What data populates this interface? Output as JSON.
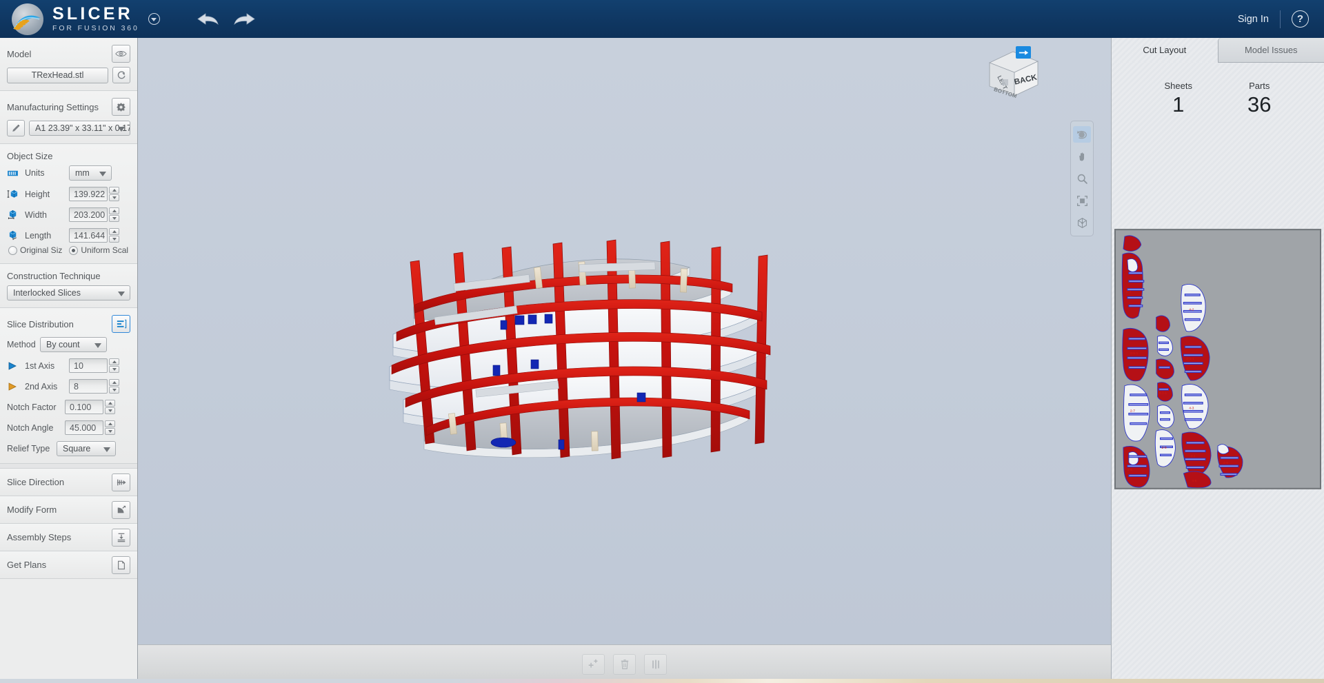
{
  "app": {
    "logo_title": "SLICER",
    "logo_subtitle": "FOR FUSION 360",
    "signin_label": "Sign In",
    "help_label": "?",
    "undo_icon": "undo-arrow-icon",
    "redo_icon": "redo-arrow-icon",
    "logo_menu_icon": "chevron-down-circle-icon"
  },
  "sidebar": {
    "model": {
      "title": "Model",
      "visibility_icon": "eye-icon",
      "refresh_icon": "refresh-icon",
      "file_name": "TRexHead.stl"
    },
    "manufacturing": {
      "title": "Manufacturing Settings",
      "gear_icon": "gear-icon",
      "edit_icon": "pencil-icon",
      "sheet_value": "A1 23.39\" x 33.11\" x 0.17"
    },
    "object_size": {
      "title": "Object Size",
      "units_label": "Units",
      "units_value": "mm",
      "units_icon": "ruler-icon",
      "height_label": "Height",
      "height_value": "139.922",
      "height_icon": "height-cube-icon",
      "width_label": "Width",
      "width_value": "203.200",
      "width_icon": "width-cube-icon",
      "length_label": "Length",
      "length_value": "141.644",
      "length_icon": "length-cube-icon",
      "original_size_label": "Original Siz",
      "uniform_scale_label": "Uniform Scal",
      "scale_mode": "uniform"
    },
    "construction": {
      "title": "Construction Technique",
      "value": "Interlocked Slices"
    },
    "slice_distribution": {
      "title": "Slice Distribution",
      "panel_icon": "slice-distribution-icon",
      "method_label": "Method",
      "method_value": "By count",
      "axis1_label": "1st Axis",
      "axis1_value": "10",
      "axis1_icon": "blue-triangle-icon",
      "axis2_label": "2nd Axis",
      "axis2_value": "8",
      "axis2_icon": "orange-triangle-icon",
      "notch_factor_label": "Notch Factor",
      "notch_factor_value": "0.100",
      "notch_angle_label": "Notch Angle",
      "notch_angle_value": "45.000",
      "relief_type_label": "Relief Type",
      "relief_type_value": "Square"
    },
    "sections": [
      {
        "title": "Slice Direction",
        "icon": "slice-direction-icon"
      },
      {
        "title": "Modify Form",
        "icon": "modify-form-icon"
      },
      {
        "title": "Assembly Steps",
        "icon": "assembly-steps-icon"
      },
      {
        "title": "Get Plans",
        "icon": "get-plans-icon"
      }
    ]
  },
  "viewport": {
    "viewcube": {
      "front_face": "BACK",
      "left_face": "LEFT",
      "bottom_face": "BOTTOM"
    },
    "viewcube_arrow_icon": "arrow-right-icon",
    "tools": [
      {
        "name": "orbit-tool",
        "icon": "orbit-icon",
        "active": true
      },
      {
        "name": "pan-tool",
        "icon": "hand-icon",
        "active": false
      },
      {
        "name": "zoom-tool",
        "icon": "magnifier-icon",
        "active": false
      },
      {
        "name": "fit-view-tool",
        "icon": "fit-frame-icon",
        "active": false
      },
      {
        "name": "iso-view-tool",
        "icon": "isometric-cube-icon",
        "active": false
      }
    ]
  },
  "bottom_toolbar": [
    {
      "name": "add-slice-button",
      "icon": "add-plus-icon"
    },
    {
      "name": "delete-slice-button",
      "icon": "trash-icon"
    },
    {
      "name": "slice-spacing-button",
      "icon": "slice-bars-icon"
    }
  ],
  "right_panel": {
    "tabs": [
      {
        "label": "Cut Layout",
        "active": true
      },
      {
        "label": "Model Issues",
        "active": false
      }
    ],
    "stats": [
      {
        "label": "Sheets",
        "value": "1"
      },
      {
        "label": "Parts",
        "value": "36"
      }
    ]
  },
  "colors": {
    "brand_blue": "#0f3762",
    "accent_blue": "#1a8ae0",
    "part_red": "#b51016",
    "part_outline": "#2b35c8",
    "viewport_bg": "#c3ccd9",
    "panel_bg": "#eceded"
  }
}
